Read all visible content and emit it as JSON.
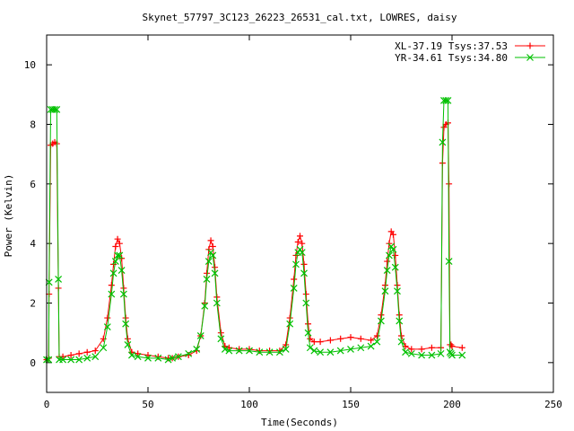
{
  "chart_data": {
    "type": "line",
    "title": "Skynet_57797_3C123_26223_26531_cal.txt, LOWRES, daisy",
    "xlabel": "Time(Seconds)",
    "ylabel": "Power (Kelvin)",
    "xlim": [
      0,
      250
    ],
    "ylim": [
      -1,
      11
    ],
    "xticks": [
      0,
      50,
      100,
      150,
      200,
      250
    ],
    "yticks": [
      0,
      2,
      4,
      6,
      8,
      10
    ],
    "grid": false,
    "legend_position": "top-right",
    "series": [
      {
        "name": "XL-37.19 Tsys:37.53",
        "color": "#ff0000",
        "marker": "plus",
        "x": [
          0,
          1,
          1.2,
          2,
          3,
          4,
          5,
          5.8,
          6.2,
          8,
          12,
          16,
          20,
          24,
          28,
          30,
          32,
          33,
          34,
          35,
          36,
          37,
          38,
          39,
          40,
          42,
          45,
          50,
          55,
          60,
          62,
          65,
          70,
          74,
          76,
          78,
          79,
          80,
          81,
          82,
          83,
          84,
          86,
          88,
          90,
          95,
          100,
          105,
          110,
          115,
          118,
          120,
          122,
          123,
          124,
          125,
          126,
          127,
          128,
          129,
          130,
          132,
          135,
          140,
          145,
          150,
          155,
          160,
          163,
          165,
          167,
          168,
          169,
          170,
          171,
          172,
          173,
          174,
          175,
          177,
          180,
          185,
          190,
          194.5,
          195.3,
          196,
          197,
          198,
          198.5,
          199,
          199.5,
          200,
          205
        ],
        "y": [
          0.1,
          0.15,
          2.3,
          7.3,
          7.35,
          7.4,
          7.35,
          2.5,
          0.2,
          0.2,
          0.25,
          0.3,
          0.35,
          0.4,
          0.8,
          1.5,
          2.6,
          3.3,
          3.9,
          4.15,
          4.0,
          3.5,
          2.5,
          1.5,
          0.8,
          0.35,
          0.3,
          0.25,
          0.2,
          0.15,
          0.15,
          0.2,
          0.25,
          0.4,
          0.9,
          2.0,
          3.0,
          3.8,
          4.1,
          3.9,
          3.2,
          2.2,
          1.0,
          0.55,
          0.5,
          0.45,
          0.45,
          0.4,
          0.4,
          0.4,
          0.6,
          1.5,
          2.8,
          3.6,
          4.05,
          4.25,
          4.0,
          3.3,
          2.3,
          1.3,
          0.8,
          0.7,
          0.7,
          0.75,
          0.8,
          0.85,
          0.8,
          0.75,
          0.9,
          1.6,
          2.6,
          3.4,
          4.0,
          4.4,
          4.3,
          3.6,
          2.6,
          1.6,
          0.9,
          0.55,
          0.45,
          0.45,
          0.5,
          0.5,
          6.7,
          7.9,
          8.0,
          8.05,
          6.0,
          0.6,
          0.6,
          0.55,
          0.5
        ]
      },
      {
        "name": "YR-34.61 Tsys:34.80",
        "color": "#00c000",
        "marker": "cross",
        "x": [
          0,
          1,
          1.2,
          2,
          3,
          4,
          5,
          5.8,
          6.2,
          8,
          12,
          16,
          20,
          24,
          28,
          30,
          32,
          33,
          34,
          35,
          36,
          37,
          38,
          39,
          40,
          42,
          45,
          50,
          55,
          60,
          62,
          65,
          70,
          74,
          76,
          78,
          79,
          80,
          81,
          82,
          83,
          84,
          86,
          88,
          90,
          95,
          100,
          105,
          110,
          115,
          118,
          120,
          122,
          123,
          124,
          125,
          126,
          127,
          128,
          129,
          130,
          132,
          135,
          140,
          145,
          150,
          155,
          160,
          163,
          165,
          167,
          168,
          169,
          170,
          171,
          172,
          173,
          174,
          175,
          177,
          180,
          185,
          190,
          194.5,
          195.3,
          196,
          197,
          198,
          198.5,
          199,
          199.5,
          200,
          205
        ],
        "y": [
          0.1,
          0.1,
          2.7,
          8.5,
          8.5,
          8.5,
          8.5,
          2.8,
          0.1,
          0.1,
          0.1,
          0.1,
          0.15,
          0.2,
          0.5,
          1.2,
          2.3,
          3.0,
          3.4,
          3.6,
          3.6,
          3.1,
          2.3,
          1.3,
          0.6,
          0.25,
          0.2,
          0.15,
          0.15,
          0.1,
          0.15,
          0.2,
          0.3,
          0.45,
          0.9,
          1.9,
          2.8,
          3.4,
          3.7,
          3.6,
          3.0,
          2.0,
          0.8,
          0.45,
          0.4,
          0.4,
          0.4,
          0.35,
          0.35,
          0.35,
          0.45,
          1.3,
          2.5,
          3.3,
          3.7,
          3.8,
          3.7,
          3.0,
          2.0,
          1.0,
          0.5,
          0.4,
          0.35,
          0.35,
          0.4,
          0.45,
          0.5,
          0.55,
          0.7,
          1.4,
          2.4,
          3.1,
          3.6,
          3.9,
          3.8,
          3.2,
          2.4,
          1.4,
          0.7,
          0.35,
          0.3,
          0.25,
          0.25,
          0.3,
          7.4,
          8.8,
          8.8,
          8.8,
          3.4,
          0.35,
          0.3,
          0.25,
          0.25
        ]
      }
    ]
  }
}
